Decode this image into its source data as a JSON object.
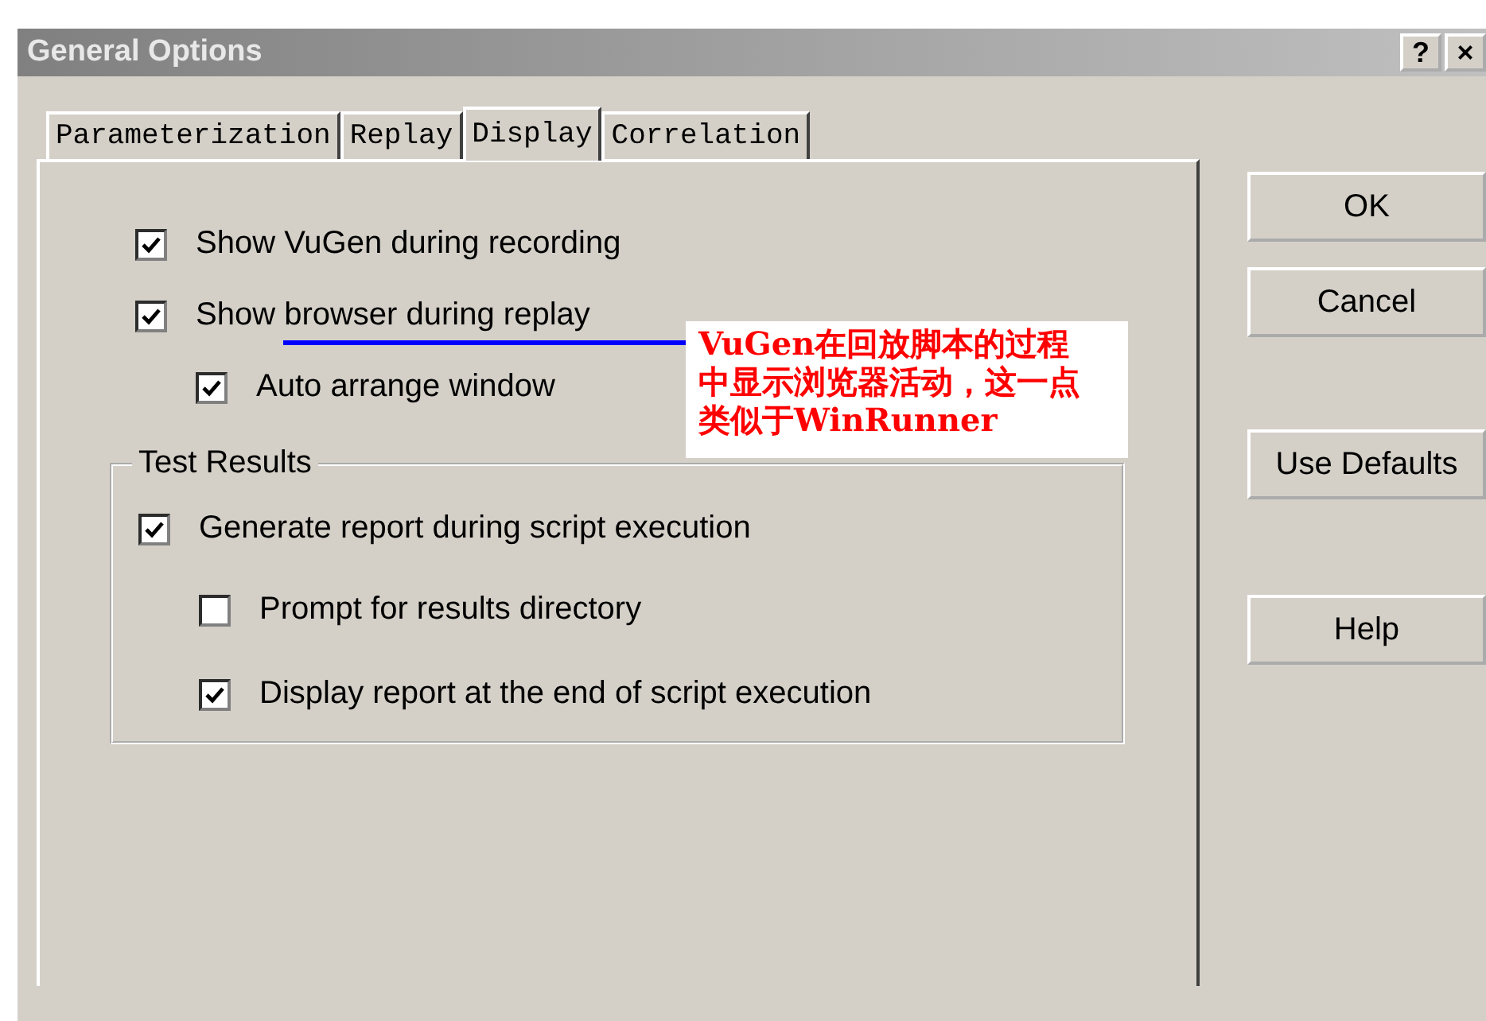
{
  "window": {
    "title": "General Options",
    "title_buttons": [
      "?",
      "×"
    ]
  },
  "tabs": [
    {
      "label": "Parameterization",
      "selected": false
    },
    {
      "label": "Replay",
      "selected": false
    },
    {
      "label": "Display",
      "selected": true
    },
    {
      "label": "Correlation",
      "selected": false
    }
  ],
  "display_options": [
    {
      "label": "Show VuGen during recording",
      "checked": true
    },
    {
      "label": "Show browser during replay",
      "checked": true,
      "children": [
        {
          "label": "Auto arrange window",
          "checked": true
        }
      ]
    }
  ],
  "test_results": {
    "title": "Test Results",
    "options": [
      {
        "label": "Generate report during script execution",
        "checked": true,
        "children": [
          {
            "label": "Prompt for results directory",
            "checked": false
          },
          {
            "label": "Display report at the end of script execution",
            "checked": true
          }
        ]
      }
    ]
  },
  "annotation": {
    "text": "VuGen在回放脚本的过程中显示浏览器活动，这一点类似于WinRunner"
  },
  "buttons": [
    {
      "label": "OK"
    },
    {
      "label": "Cancel"
    },
    {
      "label": "Use Defaults"
    },
    {
      "label": "Help"
    }
  ]
}
